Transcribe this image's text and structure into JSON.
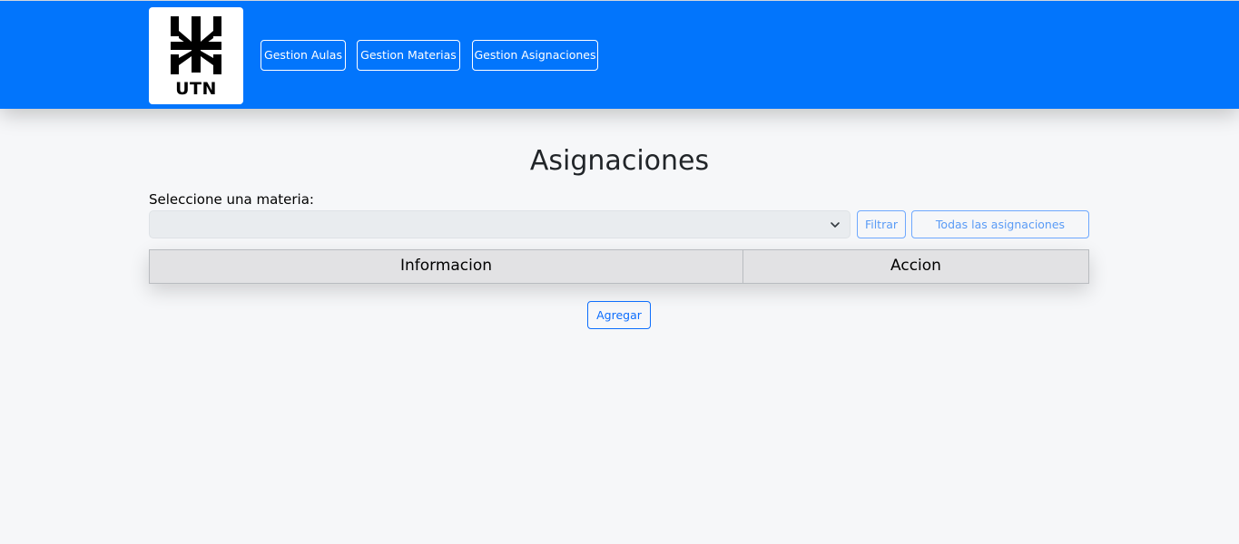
{
  "header": {
    "logo_text": "UTN",
    "nav": [
      {
        "label": "Gestion Aulas"
      },
      {
        "label": "Gestion Materias"
      },
      {
        "label": "Gestion Asignaciones"
      }
    ]
  },
  "main": {
    "title": "Asignaciones",
    "select_label": "Seleccione una materia:",
    "select_value": "",
    "filter_button": "Filtrar",
    "all_button": "Todas las asignaciones",
    "table": {
      "columns": [
        "Informacion",
        "Accion"
      ],
      "rows": []
    },
    "add_button": "Agregar"
  },
  "colors": {
    "navbar": "#0275fc",
    "page_bg": "#f6f7f9",
    "primary": "#0d6efd"
  }
}
